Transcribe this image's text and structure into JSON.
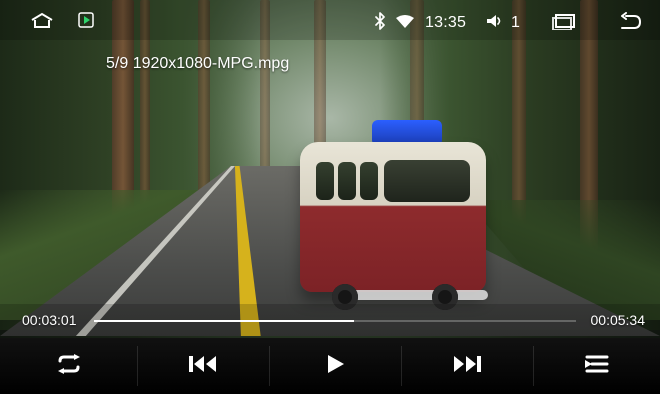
{
  "statusbar": {
    "clock": "13:35",
    "volume_level": "1",
    "icons": [
      "home-icon",
      "play-store-icon",
      "bluetooth-icon",
      "wifi-icon",
      "volume-icon",
      "recents-icon",
      "back-icon"
    ]
  },
  "player": {
    "title": "5/9 1920x1080-MPG.mpg",
    "elapsed": "00:03:01",
    "duration": "00:05:34",
    "progress_fraction": 0.54
  },
  "controls": {
    "items": [
      {
        "icon": "repeat-icon"
      },
      {
        "icon": "previous-track-icon"
      },
      {
        "icon": "play-icon"
      },
      {
        "icon": "next-track-icon"
      },
      {
        "icon": "playlist-icon"
      }
    ]
  },
  "colors": {
    "accent": "#ffffff",
    "overlay": "#000000"
  }
}
